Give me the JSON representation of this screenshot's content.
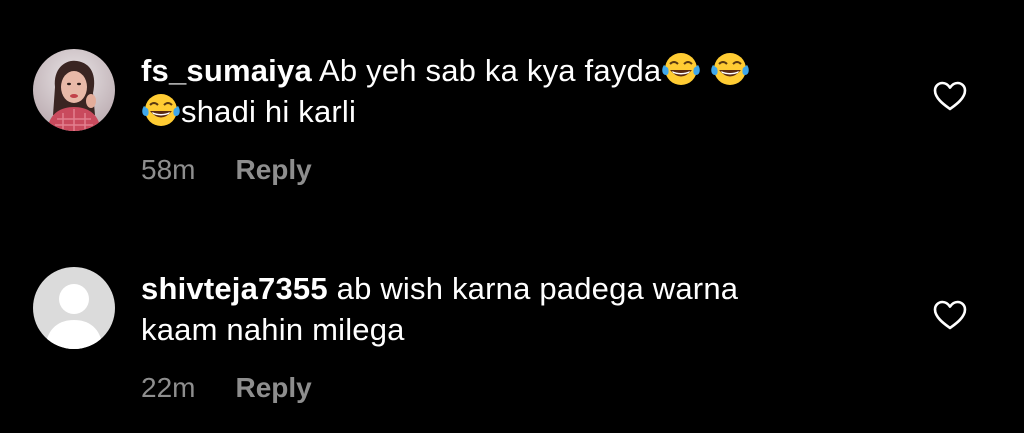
{
  "comments": [
    {
      "username": "fs_sumaiya",
      "text_part_1": "Ab yeh sab ka kya fayda",
      "text_part_2": "shadi hi karli",
      "emoji_name": "face-with-tears-of-joy",
      "time": "58m",
      "reply_label": "Reply",
      "avatar": "profile-photo"
    },
    {
      "username": "shivteja7355",
      "text_part_1": "ab wish karna padega warna",
      "text_part_2": "kaam nahin milega",
      "time": "22m",
      "reply_label": "Reply",
      "avatar": "default-avatar"
    }
  ],
  "colors": {
    "background": "#000000",
    "text": "#ffffff",
    "meta": "#8e8e8e"
  },
  "icons": {
    "like": "heart-outline-icon"
  }
}
